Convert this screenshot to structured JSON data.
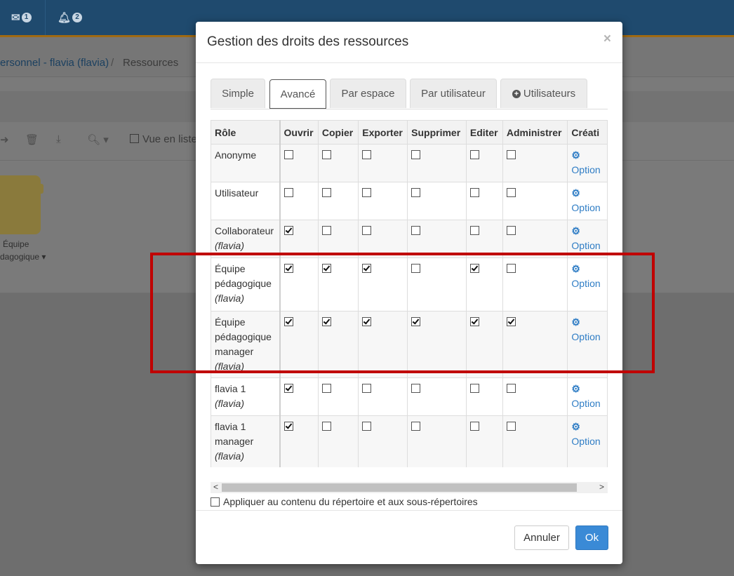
{
  "background": {
    "mail_count": "1",
    "notif_count": "2",
    "breadcrumb_link": "ersonnel - flavia (flavia)",
    "breadcrumb_sep": "/",
    "breadcrumb_current": "Ressources",
    "vue_liste": "Vue en liste",
    "folder_label_line1": "Équipe",
    "folder_label_line2": "dagogique ▾"
  },
  "modal": {
    "title": "Gestion des droits des ressources",
    "close": "×",
    "tabs": [
      {
        "label": "Simple"
      },
      {
        "label": "Avancé"
      },
      {
        "label": "Par espace"
      },
      {
        "label": "Par utilisateur"
      },
      {
        "label": "Utilisateurs"
      }
    ],
    "columns": [
      "Rôle",
      "Ouvrir",
      "Copier",
      "Exporter",
      "Supprimer",
      "Editer",
      "Administrer",
      "Créati"
    ],
    "rows": [
      {
        "role": "Anonyme",
        "sub": "",
        "perms": [
          false,
          false,
          false,
          false,
          false,
          false
        ],
        "option": "Option"
      },
      {
        "role": "Utilisateur",
        "sub": "",
        "perms": [
          false,
          false,
          false,
          false,
          false,
          false
        ],
        "option": "Option"
      },
      {
        "role": "Collaborateur",
        "sub": "(flavia)",
        "perms": [
          true,
          false,
          false,
          false,
          false,
          false
        ],
        "option": "Option"
      },
      {
        "role": "Équipe pédagogique",
        "sub": "(flavia)",
        "perms": [
          true,
          true,
          true,
          false,
          true,
          false
        ],
        "option": "Option"
      },
      {
        "role": "Équipe pédagogique manager",
        "sub": "(flavia)",
        "perms": [
          true,
          true,
          true,
          true,
          true,
          true
        ],
        "option": "Option"
      },
      {
        "role": "flavia 1",
        "sub": "(flavia)",
        "perms": [
          true,
          false,
          false,
          false,
          false,
          false
        ],
        "option": "Option"
      },
      {
        "role": "flavia 1 manager",
        "sub": "(flavia)",
        "perms": [
          true,
          false,
          false,
          false,
          false,
          false
        ],
        "option": "Option"
      }
    ],
    "apply_label": "Appliquer au contenu du répertoire et aux sous-répertoires",
    "cancel_label": "Annuler",
    "ok_label": "Ok"
  }
}
